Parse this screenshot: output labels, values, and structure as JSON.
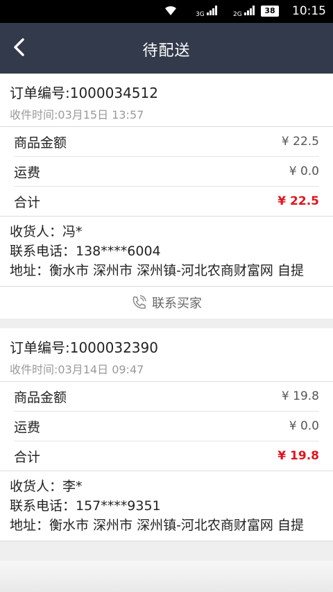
{
  "status_bar": {
    "network1": "3G",
    "network2": "2G",
    "battery": "38",
    "time": "10:15"
  },
  "nav": {
    "title": "待配送"
  },
  "orders": [
    {
      "order_no": "订单编号:1000034512",
      "receive_time": "收件时间:03月15日  13:57",
      "goods_label": "商品金额",
      "goods_amount": "¥ 22.5",
      "freight_label": "运费",
      "freight_amount": "¥ 0.0",
      "total_label": "合计",
      "total_amount": "¥ 22.5",
      "receiver": "收货人：冯*",
      "phone": "联系电话：138****6004",
      "address": "地址：衡水市 深州市 深州镇-河北农商财富网 自提",
      "contact_label": "联系买家"
    },
    {
      "order_no": "订单编号:1000032390",
      "receive_time": "收件时间:03月14日  09:47",
      "goods_label": "商品金额",
      "goods_amount": "¥ 19.8",
      "freight_label": "运费",
      "freight_amount": "¥ 0.0",
      "total_label": "合计",
      "total_amount": "¥ 19.8",
      "receiver": "收货人：李*",
      "phone": "联系电话：157****9351",
      "address": "地址：衡水市 深州市 深州镇-河北农商财富网 自提"
    }
  ]
}
